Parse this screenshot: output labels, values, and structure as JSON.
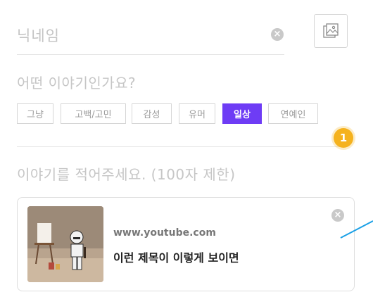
{
  "nickname": {
    "placeholder": "닉네임",
    "clear_icon": "×"
  },
  "image_button": {
    "icon": "image-icon"
  },
  "category_question": "어떤 이야기인가요?",
  "categories": [
    {
      "label": "그냥",
      "active": false
    },
    {
      "label": "고백/고민",
      "active": false
    },
    {
      "label": "감성",
      "active": false
    },
    {
      "label": "유머",
      "active": false
    },
    {
      "label": "일상",
      "active": true
    },
    {
      "label": "연예인",
      "active": false
    }
  ],
  "step_badge": "1",
  "story_placeholder": "이야기를 적어주세요. (100자 제한)",
  "link_preview": {
    "url": "www.youtube.com",
    "title": "이런 제목이 이렇게 보이면",
    "close_icon": "×"
  },
  "colors": {
    "accent": "#6e3cf5",
    "badge": "#f5b21e",
    "pointer": "#1aa0e6"
  }
}
